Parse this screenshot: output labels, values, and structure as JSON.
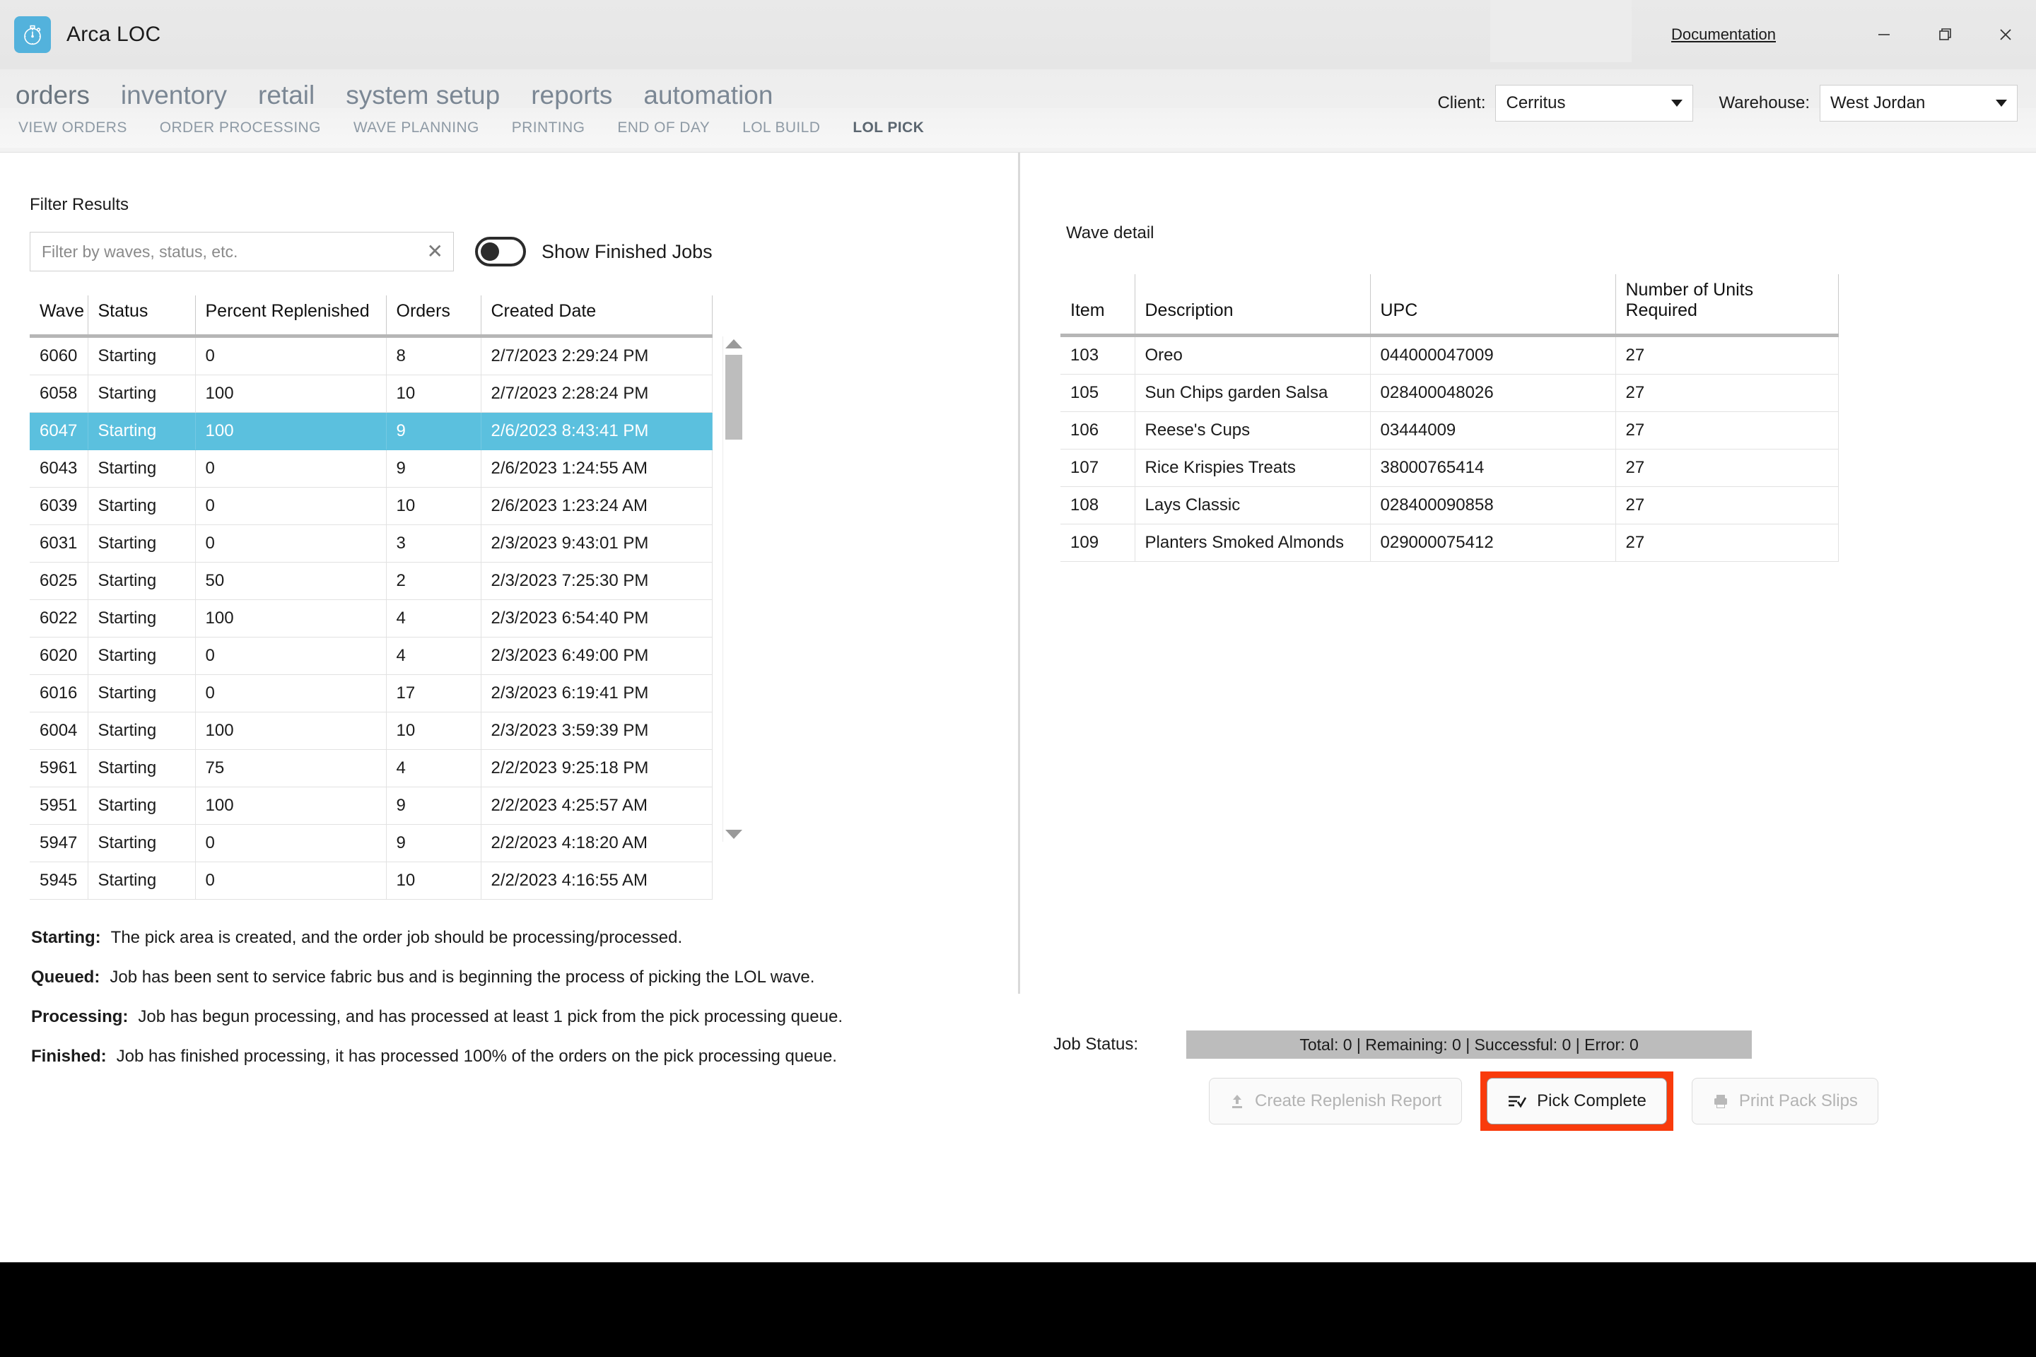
{
  "window": {
    "app_title": "Arca LOC",
    "app_icon": "stopwatch-icon",
    "documentation_link": "Documentation",
    "minimize": "minimize-icon",
    "maximize": "maximize-icon",
    "close": "close-icon",
    "accent_color": "#53b2dc"
  },
  "mainnav": {
    "items": [
      {
        "label": "orders",
        "active": true
      },
      {
        "label": "inventory",
        "active": false
      },
      {
        "label": "retail",
        "active": false
      },
      {
        "label": "system setup",
        "active": false
      },
      {
        "label": "reports",
        "active": false
      },
      {
        "label": "automation",
        "active": false
      }
    ]
  },
  "subnav": {
    "items": [
      {
        "label": "VIEW ORDERS",
        "active": false
      },
      {
        "label": "ORDER PROCESSING",
        "active": false
      },
      {
        "label": "WAVE PLANNING",
        "active": false
      },
      {
        "label": "PRINTING",
        "active": false
      },
      {
        "label": "END OF DAY",
        "active": false
      },
      {
        "label": "LOL BUILD",
        "active": false
      },
      {
        "label": "LOL PICK",
        "active": true
      }
    ]
  },
  "selectors": {
    "client_label": "Client:",
    "client_value": "Cerritus",
    "warehouse_label": "Warehouse:",
    "warehouse_value": "West Jordan"
  },
  "filter": {
    "title": "Filter Results",
    "placeholder": "Filter by waves, status, etc.",
    "value": "",
    "clear_icon": "clear-icon",
    "toggle_label": "Show Finished Jobs",
    "toggle_on": false
  },
  "waves_table": {
    "columns": [
      "Wave",
      "Status",
      "Percent Replenished",
      "Orders",
      "Created Date"
    ],
    "selected_wave": "6047",
    "rows": [
      {
        "wave": "6060",
        "status": "Starting",
        "percent": "0",
        "orders": "8",
        "created": "2/7/2023 2:29:24 PM",
        "selected": false
      },
      {
        "wave": "6058",
        "status": "Starting",
        "percent": "100",
        "orders": "10",
        "created": "2/7/2023 2:28:24 PM",
        "selected": false
      },
      {
        "wave": "6047",
        "status": "Starting",
        "percent": "100",
        "orders": "9",
        "created": "2/6/2023 8:43:41 PM",
        "selected": true
      },
      {
        "wave": "6043",
        "status": "Starting",
        "percent": "0",
        "orders": "9",
        "created": "2/6/2023 1:24:55 AM",
        "selected": false
      },
      {
        "wave": "6039",
        "status": "Starting",
        "percent": "0",
        "orders": "10",
        "created": "2/6/2023 1:23:24 AM",
        "selected": false
      },
      {
        "wave": "6031",
        "status": "Starting",
        "percent": "0",
        "orders": "3",
        "created": "2/3/2023 9:43:01 PM",
        "selected": false
      },
      {
        "wave": "6025",
        "status": "Starting",
        "percent": "50",
        "orders": "2",
        "created": "2/3/2023 7:25:30 PM",
        "selected": false
      },
      {
        "wave": "6022",
        "status": "Starting",
        "percent": "100",
        "orders": "4",
        "created": "2/3/2023 6:54:40 PM",
        "selected": false
      },
      {
        "wave": "6020",
        "status": "Starting",
        "percent": "0",
        "orders": "4",
        "created": "2/3/2023 6:49:00 PM",
        "selected": false
      },
      {
        "wave": "6016",
        "status": "Starting",
        "percent": "0",
        "orders": "17",
        "created": "2/3/2023 6:19:41 PM",
        "selected": false
      },
      {
        "wave": "6004",
        "status": "Starting",
        "percent": "100",
        "orders": "10",
        "created": "2/3/2023 3:59:39 PM",
        "selected": false
      },
      {
        "wave": "5961",
        "status": "Starting",
        "percent": "75",
        "orders": "4",
        "created": "2/2/2023 9:25:18 PM",
        "selected": false
      },
      {
        "wave": "5951",
        "status": "Starting",
        "percent": "100",
        "orders": "9",
        "created": "2/2/2023 4:25:57 AM",
        "selected": false
      },
      {
        "wave": "5947",
        "status": "Starting",
        "percent": "0",
        "orders": "9",
        "created": "2/2/2023 4:18:20 AM",
        "selected": false
      },
      {
        "wave": "5945",
        "status": "Starting",
        "percent": "0",
        "orders": "10",
        "created": "2/2/2023 4:16:55 AM",
        "selected": false
      }
    ],
    "scrollbar": {
      "up_icon": "scroll-up-icon",
      "down_icon": "scroll-down-icon"
    }
  },
  "legend": [
    {
      "term": "Starting:",
      "text": "The pick area is created, and the order job should be processing/processed."
    },
    {
      "term": "Queued:",
      "text": "Job has been sent to service fabric bus and is beginning the process of picking the LOL wave."
    },
    {
      "term": "Processing:",
      "text": "Job has begun processing, and has processed at least 1 pick from the pick processing queue."
    },
    {
      "term": "Finished:",
      "text": "Job has finished processing, it has processed 100% of the orders on the pick processing queue."
    }
  ],
  "wave_detail": {
    "title": "Wave detail",
    "columns": [
      "Item",
      "Description",
      "UPC",
      "Number of Units Required"
    ],
    "rows": [
      {
        "item": "103",
        "description": "Oreo",
        "upc": "044000047009",
        "units": "27"
      },
      {
        "item": "105",
        "description": "Sun Chips garden Salsa",
        "upc": "028400048026",
        "units": "27"
      },
      {
        "item": "106",
        "description": "Reese's Cups",
        "upc": "03444009",
        "units": "27"
      },
      {
        "item": "107",
        "description": "Rice Krispies Treats",
        "upc": "38000765414",
        "units": "27"
      },
      {
        "item": "108",
        "description": "Lays Classic",
        "upc": "028400090858",
        "units": "27"
      },
      {
        "item": "109",
        "description": "Planters Smoked Almonds",
        "upc": "029000075412",
        "units": "27"
      }
    ]
  },
  "job_status": {
    "label": "Job Status:",
    "text": "Total: 0 | Remaining: 0 | Successful: 0 | Error: 0"
  },
  "actions": {
    "create_replenish_report": "Create Replenish Report",
    "pick_complete": "Pick Complete",
    "print_pack_slips": "Print Pack Slips",
    "highlight_color": "#f93b0c"
  }
}
